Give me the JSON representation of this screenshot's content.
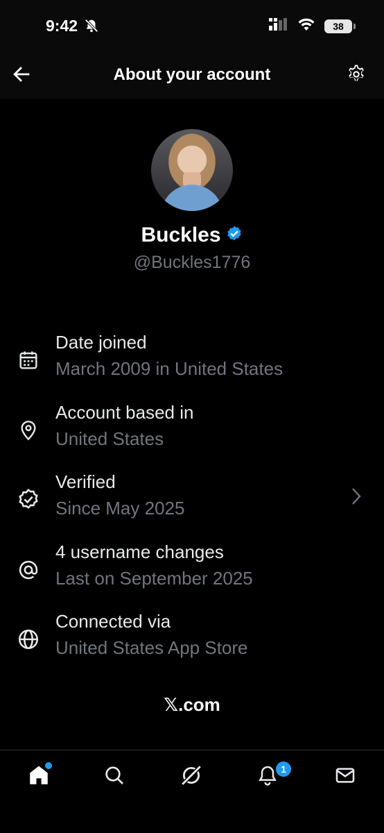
{
  "status": {
    "time": "9:42",
    "battery": "38"
  },
  "header": {
    "title": "About your account"
  },
  "profile": {
    "name": "Buckles",
    "handle": "@Buckles1776"
  },
  "details": [
    {
      "title": "Date joined",
      "subtitle": "March 2009 in United States",
      "icon": "calendar-icon"
    },
    {
      "title": "Account based in",
      "subtitle": "United States",
      "icon": "location-pin-icon"
    },
    {
      "title": "Verified",
      "subtitle": "Since May 2025",
      "icon": "verified-badge-icon"
    },
    {
      "title": "4 username changes",
      "subtitle": "Last on September 2025",
      "icon": "at-sign-icon"
    },
    {
      "title": "Connected via",
      "subtitle": "United States App Store",
      "icon": "globe-icon"
    }
  ],
  "footer": {
    "link": "𝕏.com"
  },
  "tabs": {
    "notifications_badge": "1"
  },
  "colors": {
    "accent": "#1d9bf0",
    "muted": "#71767b",
    "background": "#000000"
  }
}
